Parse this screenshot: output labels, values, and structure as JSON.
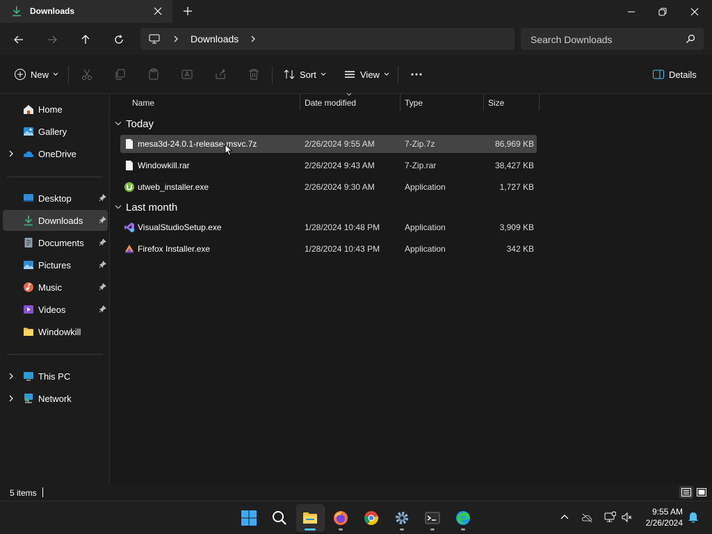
{
  "window": {
    "tab_title": "Downloads",
    "new_tab_symbol": "+"
  },
  "address": {
    "location": "Downloads"
  },
  "search": {
    "placeholder": "Search Downloads"
  },
  "commandbar": {
    "new_label": "New",
    "sort_label": "Sort",
    "view_label": "View",
    "details_label": "Details"
  },
  "sidebar": {
    "items": [
      {
        "label": "Home",
        "icon": "home-icon"
      },
      {
        "label": "Gallery",
        "icon": "gallery-icon"
      },
      {
        "label": "OneDrive",
        "icon": "cloud-icon"
      },
      {
        "label": "Desktop",
        "icon": "desktop-icon",
        "pinned": true
      },
      {
        "label": "Downloads",
        "icon": "download-icon",
        "pinned": true,
        "selected": true
      },
      {
        "label": "Documents",
        "icon": "documents-icon",
        "pinned": true
      },
      {
        "label": "Pictures",
        "icon": "pictures-icon",
        "pinned": true
      },
      {
        "label": "Music",
        "icon": "music-icon",
        "pinned": true
      },
      {
        "label": "Videos",
        "icon": "videos-icon",
        "pinned": true
      },
      {
        "label": "Windowkill",
        "icon": "folder-icon"
      },
      {
        "label": "This PC",
        "icon": "pc-icon"
      },
      {
        "label": "Network",
        "icon": "network-icon"
      }
    ]
  },
  "columns": {
    "name": "Name",
    "date": "Date modified",
    "type": "Type",
    "size": "Size"
  },
  "groups": [
    {
      "label": "Today",
      "files": [
        {
          "name": "mesa3d-24.0.1-release-msvc.7z",
          "date": "2/26/2024 9:55 AM",
          "type": "7-Zip.7z",
          "size": "86,969 KB",
          "icon": "file-icon"
        },
        {
          "name": "Windowkill.rar",
          "date": "2/26/2024 9:43 AM",
          "type": "7-Zip.rar",
          "size": "38,427 KB",
          "icon": "file-icon"
        },
        {
          "name": "utweb_installer.exe",
          "date": "2/26/2024 9:30 AM",
          "type": "Application",
          "size": "1,727 KB",
          "icon": "utorrent-icon"
        }
      ]
    },
    {
      "label": "Last month",
      "files": [
        {
          "name": "VisualStudioSetup.exe",
          "date": "1/28/2024 10:48 PM",
          "type": "Application",
          "size": "3,909 KB",
          "icon": "visual-studio-icon"
        },
        {
          "name": "Firefox Installer.exe",
          "date": "1/28/2024 10:43 PM",
          "type": "Application",
          "size": "342 KB",
          "icon": "firefox-icon"
        }
      ]
    }
  ],
  "status": {
    "item_count": "5 items"
  },
  "taskbar": {
    "time": "9:55 AM",
    "date": "2/26/2024"
  },
  "colors": {
    "accent": "#4cc2ff",
    "selected_row": "#444444"
  }
}
